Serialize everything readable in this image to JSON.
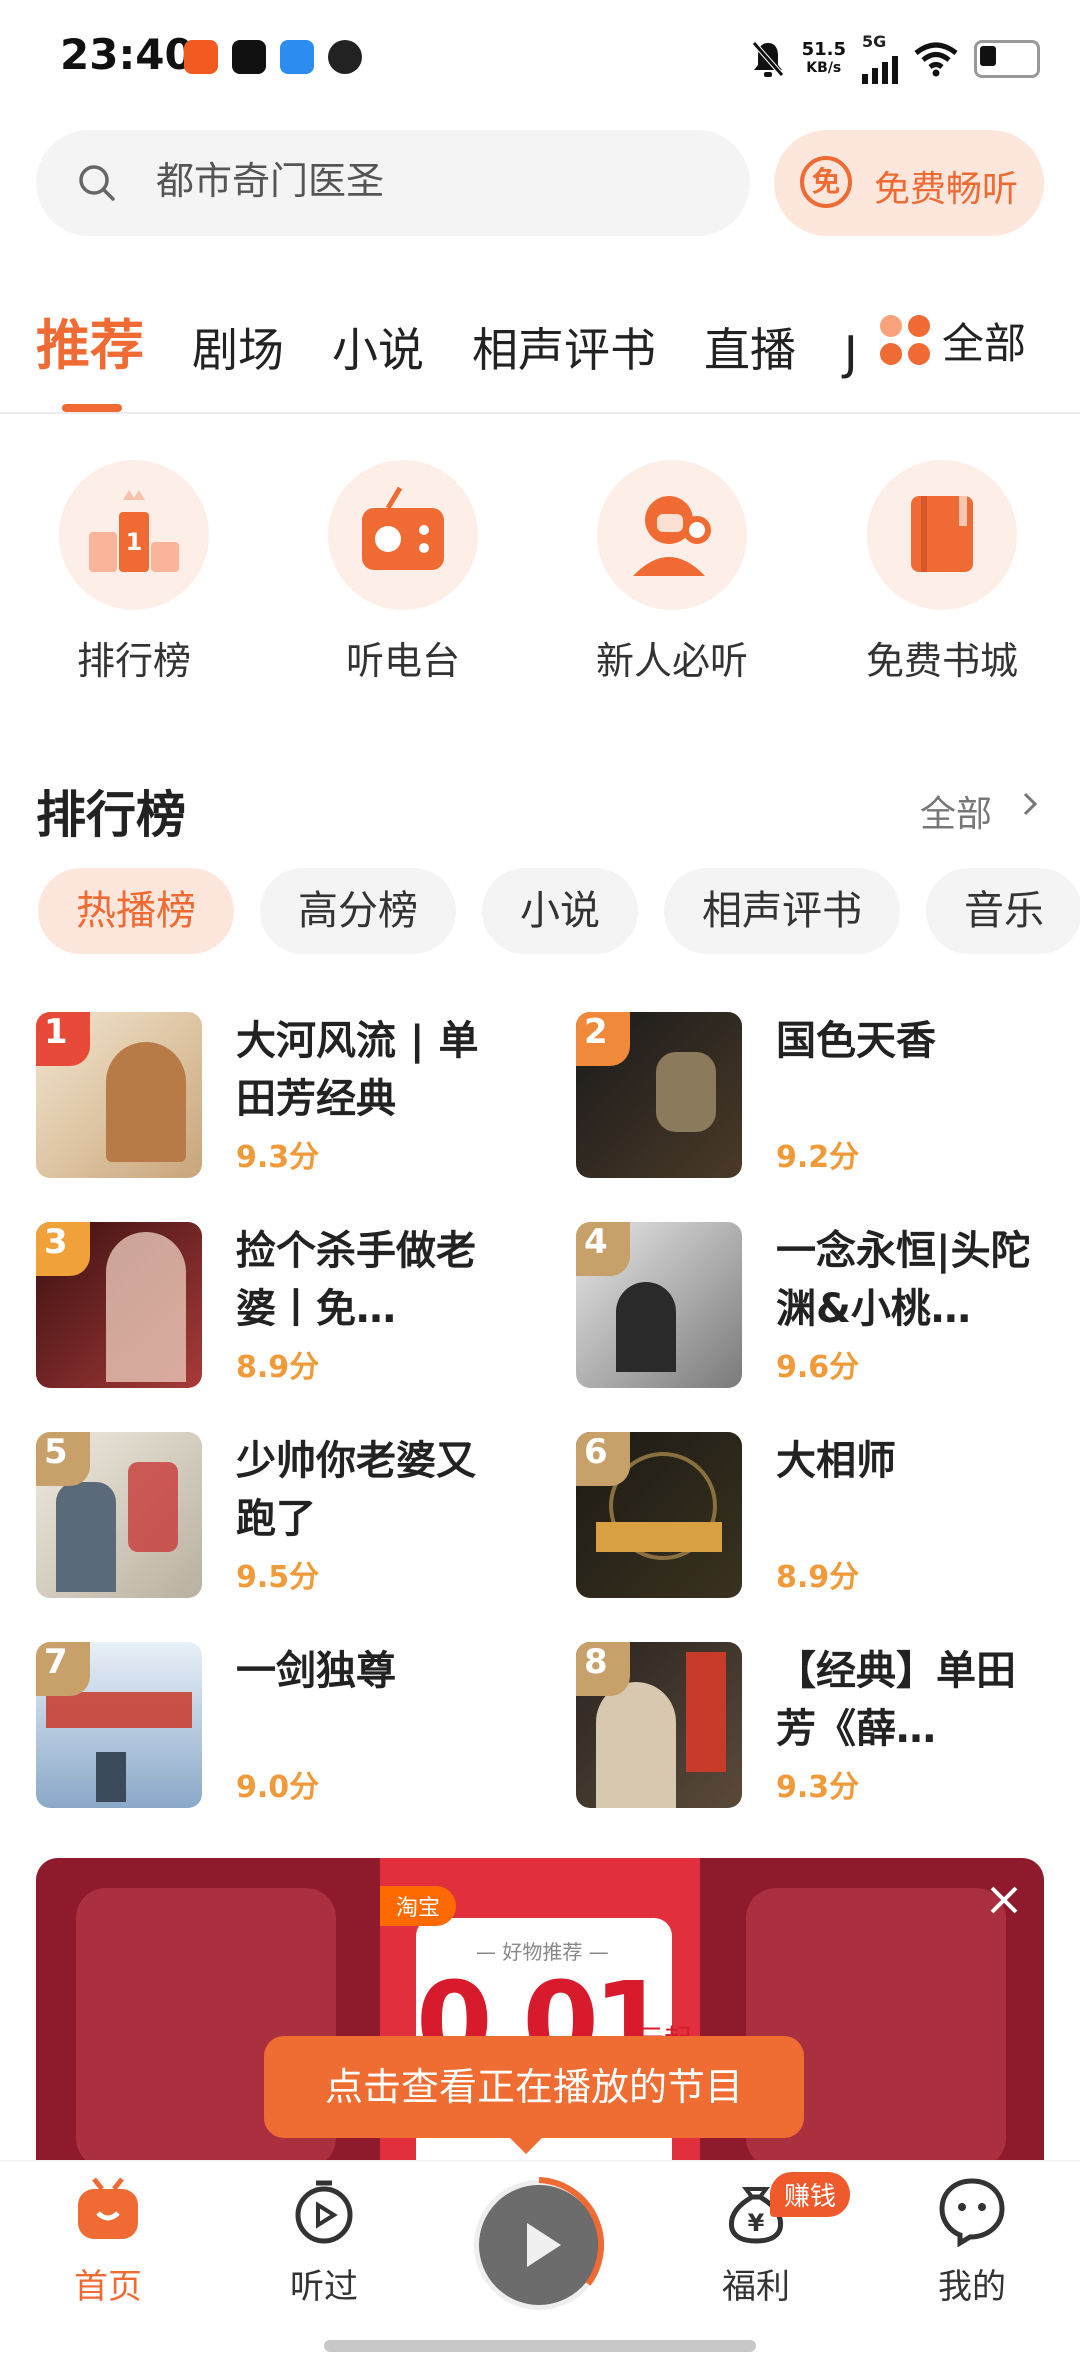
{
  "status_bar": {
    "time": "23:40",
    "network_speed": "51.5",
    "network_unit": "KB/s",
    "network_type": "5G",
    "icons": [
      "bell-off-icon",
      "signal-icon",
      "wifi-icon",
      "battery-icon"
    ]
  },
  "search": {
    "placeholder": "都市奇门医圣",
    "icon": "search-icon",
    "free_button_icon_text": "免",
    "free_button_label": "免费畅听"
  },
  "tabs": {
    "items": [
      "推荐",
      "剧场",
      "小说",
      "相声评书",
      "直播",
      "J"
    ],
    "active_index": 0,
    "all_label": "全部"
  },
  "quick_entries": [
    {
      "label": "排行榜",
      "icon": "ranking-podium-icon"
    },
    {
      "label": "听电台",
      "icon": "radio-icon"
    },
    {
      "label": "新人必听",
      "icon": "headset-user-icon"
    },
    {
      "label": "免费书城",
      "icon": "book-icon"
    }
  ],
  "ranking": {
    "title": "排行榜",
    "more": "全部",
    "chips": [
      "热播榜",
      "高分榜",
      "小说",
      "相声评书",
      "音乐"
    ],
    "active_chip": 0,
    "items": [
      {
        "rank": "1",
        "title": "大河风流 | 单田芳经典",
        "score": "9.3分"
      },
      {
        "rank": "2",
        "title": "国色天香",
        "score": "9.2分"
      },
      {
        "rank": "3",
        "title": "捡个杀手做老婆丨免…",
        "score": "8.9分"
      },
      {
        "rank": "4",
        "title": "一念永恒|头陀渊&小桃…",
        "score": "9.6分"
      },
      {
        "rank": "5",
        "title": "少帅你老婆又跑了",
        "score": "9.5分"
      },
      {
        "rank": "6",
        "title": "大相师",
        "score": "8.9分"
      },
      {
        "rank": "7",
        "title": "一剑独尊",
        "score": "9.0分"
      },
      {
        "rank": "8",
        "title": "【经典】单田芳《薛…",
        "score": "9.3分"
      }
    ]
  },
  "ad": {
    "brand": "淘宝",
    "subtitle": "— 好物推荐 —",
    "price": "0.01",
    "price_suffix": "元起"
  },
  "tooltip": "点击查看正在播放的节目",
  "bottom_nav": {
    "items": [
      "首页",
      "听过",
      "福利",
      "我的"
    ],
    "active_index": 0,
    "badge": "赚钱"
  },
  "colors": {
    "accent": "#f06a34",
    "score": "#f09a3a",
    "chip_active_bg": "#fde6dc"
  }
}
